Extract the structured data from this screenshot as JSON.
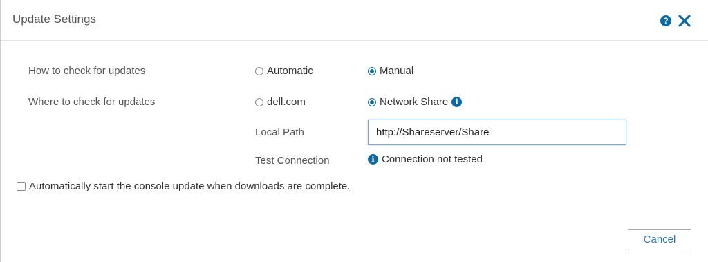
{
  "dialog": {
    "title": "Update Settings"
  },
  "how_to_check": {
    "label": "How to check for updates",
    "options": [
      {
        "label": "Automatic",
        "selected": false
      },
      {
        "label": "Manual",
        "selected": true
      }
    ]
  },
  "where_to_check": {
    "label": "Where to check for updates",
    "options": [
      {
        "label": "dell.com",
        "selected": false
      },
      {
        "label": "Network Share",
        "selected": true
      }
    ]
  },
  "local_path": {
    "label": "Local Path",
    "value": "http://Shareserver/Share"
  },
  "test_connection": {
    "label": "Test Connection",
    "status": "Connection not tested"
  },
  "auto_start": {
    "label": "Automatically start the console update when downloads are complete.",
    "checked": false
  },
  "footer": {
    "cancel_label": "Cancel"
  },
  "icons": {
    "help": "help-icon",
    "close": "close-icon",
    "info": "info-icon"
  },
  "colors": {
    "accent": "#0b6aa6",
    "link_text": "#2a7ab8"
  }
}
